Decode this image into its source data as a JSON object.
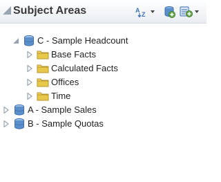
{
  "header": {
    "title": "Subject Areas"
  },
  "tree": {
    "items": [
      {
        "label": "C - Sample Headcount",
        "expanded": true,
        "icon": "subject-area-icon"
      },
      {
        "label": "Base Facts",
        "expanded": false,
        "icon": "folder-icon"
      },
      {
        "label": "Calculated Facts",
        "expanded": false,
        "icon": "folder-icon"
      },
      {
        "label": "Offices",
        "expanded": false,
        "icon": "folder-icon"
      },
      {
        "label": "Time",
        "expanded": false,
        "icon": "folder-icon"
      },
      {
        "label": "A - Sample Sales",
        "expanded": false,
        "icon": "subject-area-icon"
      },
      {
        "label": "B - Sample Quotas",
        "expanded": false,
        "icon": "subject-area-icon"
      }
    ]
  },
  "colors": {
    "header_bg": "#eef1f5",
    "folder": "#e8c84a",
    "cube": "#5b8fc9",
    "expander": "#9aa5b3"
  }
}
